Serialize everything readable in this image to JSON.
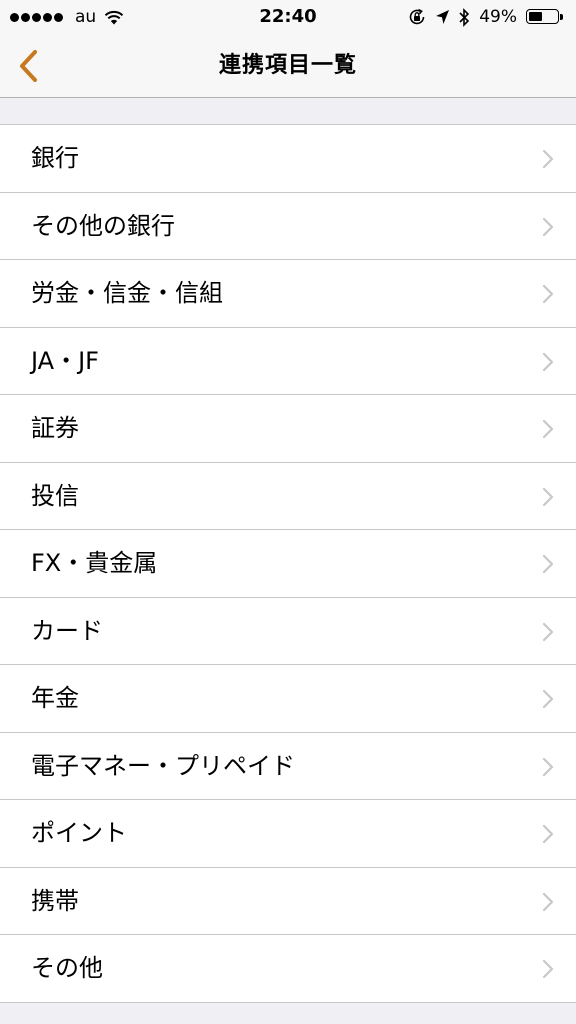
{
  "status_bar": {
    "carrier": "au",
    "time": "22:40",
    "battery_percent": "49%",
    "battery_level": 0.49,
    "icons": [
      "signal-dots",
      "wifi-icon",
      "orientation-lock-icon",
      "location-icon",
      "bluetooth-icon",
      "battery-icon"
    ]
  },
  "nav": {
    "title": "連携項目一覧",
    "back_icon": "chevron-left-icon",
    "accent_color": "#c8781e"
  },
  "list": {
    "items": [
      {
        "label": "銀行"
      },
      {
        "label": "その他の銀行"
      },
      {
        "label": "労金・信金・信組"
      },
      {
        "label": "JA・JF"
      },
      {
        "label": "証券"
      },
      {
        "label": "投信"
      },
      {
        "label": "FX・貴金属"
      },
      {
        "label": "カード"
      },
      {
        "label": "年金"
      },
      {
        "label": "電子マネー・プリペイド"
      },
      {
        "label": "ポイント"
      },
      {
        "label": "携帯"
      },
      {
        "label": "その他"
      }
    ],
    "item_icon": "chevron-right-icon"
  }
}
